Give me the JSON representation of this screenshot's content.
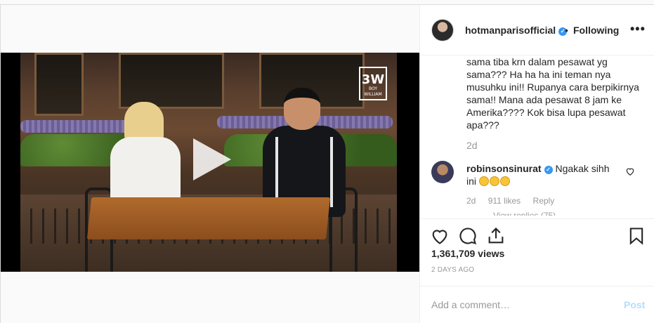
{
  "video": {
    "watermark": "3W",
    "watermark_sub": "BOY WILLIAM"
  },
  "header": {
    "username": "hotmanparisofficial",
    "separator": "•",
    "follow_label": "Following",
    "more_label": "•••"
  },
  "caption": {
    "text": "sama tiba krn dalam pesawat yg sama??? Ha ha ha ini teman nya musuhku ini!! Rupanya cara berpikirnya sama!! Mana ada pesawat 8 jam ke Amerika???? Kok bisa lupa pesawat apa???",
    "time": "2d"
  },
  "comment": {
    "username": "robinsonsinurat",
    "text": "Ngakak sihh ini",
    "time": "2d",
    "likes": "911 likes",
    "reply_label": "Reply",
    "more_text": "View replies (75)"
  },
  "stats": {
    "views": "1,361,709 views",
    "posted": "2 DAYS AGO"
  },
  "add_comment": {
    "placeholder": "Add a comment…",
    "post_label": "Post"
  },
  "colors": {
    "verified": "#3897f0",
    "post_disabled": "#b2dffc"
  }
}
